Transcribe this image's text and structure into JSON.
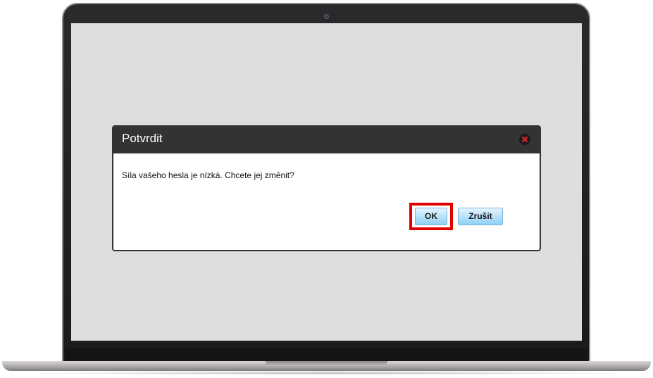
{
  "dialog": {
    "title": "Potvrdit",
    "message": "Síla vašeho hesla je nízká. Chcete jej změnit?",
    "ok_label": "OK",
    "cancel_label": "Zrušit",
    "close_icon": "close-icon"
  },
  "colors": {
    "header_bg": "#333333",
    "screen_bg": "#dedede",
    "button_gradient_top": "#e6f5ff",
    "button_gradient_bottom": "#8fd0f5",
    "highlight": "#e00000",
    "close_icon": "#e0242a"
  }
}
